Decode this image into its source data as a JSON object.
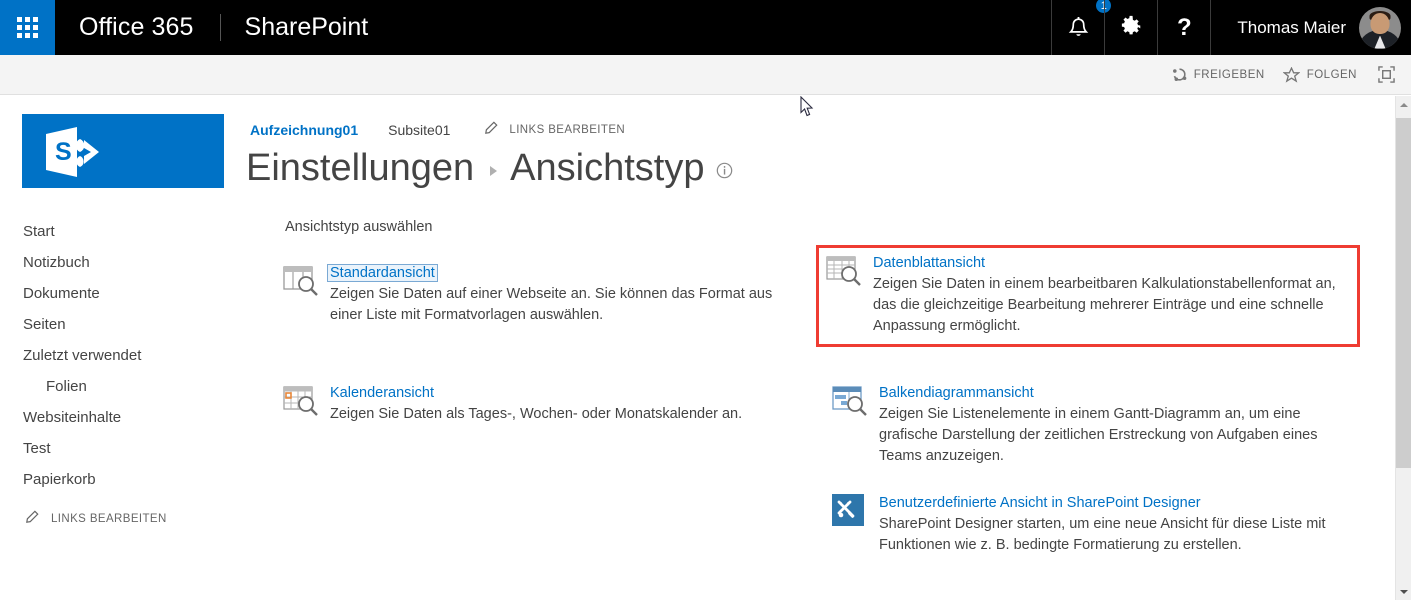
{
  "suitebar": {
    "waffle_icon": "app-launcher-waffle-icon",
    "brand": "Office 365",
    "app_name": "SharePoint",
    "notifications_icon": "bell-icon",
    "notifications_count": "1",
    "settings_icon": "gear-icon",
    "help_icon": "question-mark-icon",
    "user_name": "Thomas Maier",
    "avatar_icon": "user-avatar",
    "accent_color": "#0072c6",
    "background_color": "#000000"
  },
  "actionbar": {
    "share": {
      "label": "FREIGEBEN",
      "icon": "share-icon"
    },
    "follow": {
      "label": "FOLGEN",
      "icon": "star-icon"
    },
    "focus": {
      "label": "",
      "icon": "focus-on-content-icon"
    }
  },
  "sidebar": {
    "logo_icon": "sharepoint-site-logo",
    "items": [
      {
        "label": "Start",
        "sub": false
      },
      {
        "label": "Notizbuch",
        "sub": false
      },
      {
        "label": "Dokumente",
        "sub": false
      },
      {
        "label": "Seiten",
        "sub": false
      },
      {
        "label": "Zuletzt verwendet",
        "sub": false
      },
      {
        "label": "Folien",
        "sub": true
      },
      {
        "label": "Websiteinhalte",
        "sub": false
      },
      {
        "label": "Test",
        "sub": false
      },
      {
        "label": "Papierkorb",
        "sub": false
      }
    ],
    "edit_links": {
      "label": "LINKS BEARBEITEN",
      "icon": "pencil-icon"
    }
  },
  "breadcrumb": {
    "site": "Aufzeichnung01",
    "subsite": "Subsite01",
    "edit_links": {
      "label": "LINKS BEARBEITEN",
      "icon": "pencil-icon"
    }
  },
  "title": {
    "parent": "Einstellungen",
    "separator_icon": "chevron-right-icon",
    "current": "Ansichtstyp",
    "info_icon": "info-icon"
  },
  "main": {
    "section_label": "Ansichtstyp auswählen",
    "highlight_color": "#ef3c32",
    "highlighted_option": "datasheet",
    "focused_option": "standard",
    "options": [
      {
        "id": "standard",
        "link": "Standardansicht",
        "description": "Zeigen Sie Daten auf einer Webseite an. Sie können das Format aus einer Liste mit Formatvorlagen auswählen.",
        "icon": "standard-view-icon"
      },
      {
        "id": "calendar",
        "link": "Kalenderansicht",
        "description": "Zeigen Sie Daten als Tages-, Wochen- oder Monatskalender an.",
        "icon": "calendar-view-icon"
      },
      {
        "id": "datasheet",
        "link": "Datenblattansicht",
        "description": "Zeigen Sie Daten in einem bearbeitbaren Kalkulationstabellenformat an, das die gleichzeitige Bearbeitung mehrerer Einträge und eine schnelle Anpassung ermöglicht.",
        "icon": "datasheet-view-icon"
      },
      {
        "id": "gantt",
        "link": "Balkendiagrammansicht",
        "description": "Zeigen Sie Listenelemente in einem Gantt-Diagramm an, um eine grafische Darstellung der zeitlichen Erstreckung von Aufgaben eines Teams anzuzeigen.",
        "icon": "gantt-view-icon"
      },
      {
        "id": "designer",
        "link": "Benutzerdefinierte Ansicht in SharePoint Designer",
        "description": "SharePoint Designer starten, um eine neue Ansicht für diese Liste mit Funktionen wie z. B. bedingte Formatierung zu erstellen.",
        "icon": "sharepoint-designer-tools-icon"
      }
    ]
  },
  "scrollbar": {
    "up_icon": "chevron-up-icon",
    "down_icon": "chevron-down-icon"
  },
  "cursor": {
    "icon": "mouse-pointer-arrow"
  }
}
